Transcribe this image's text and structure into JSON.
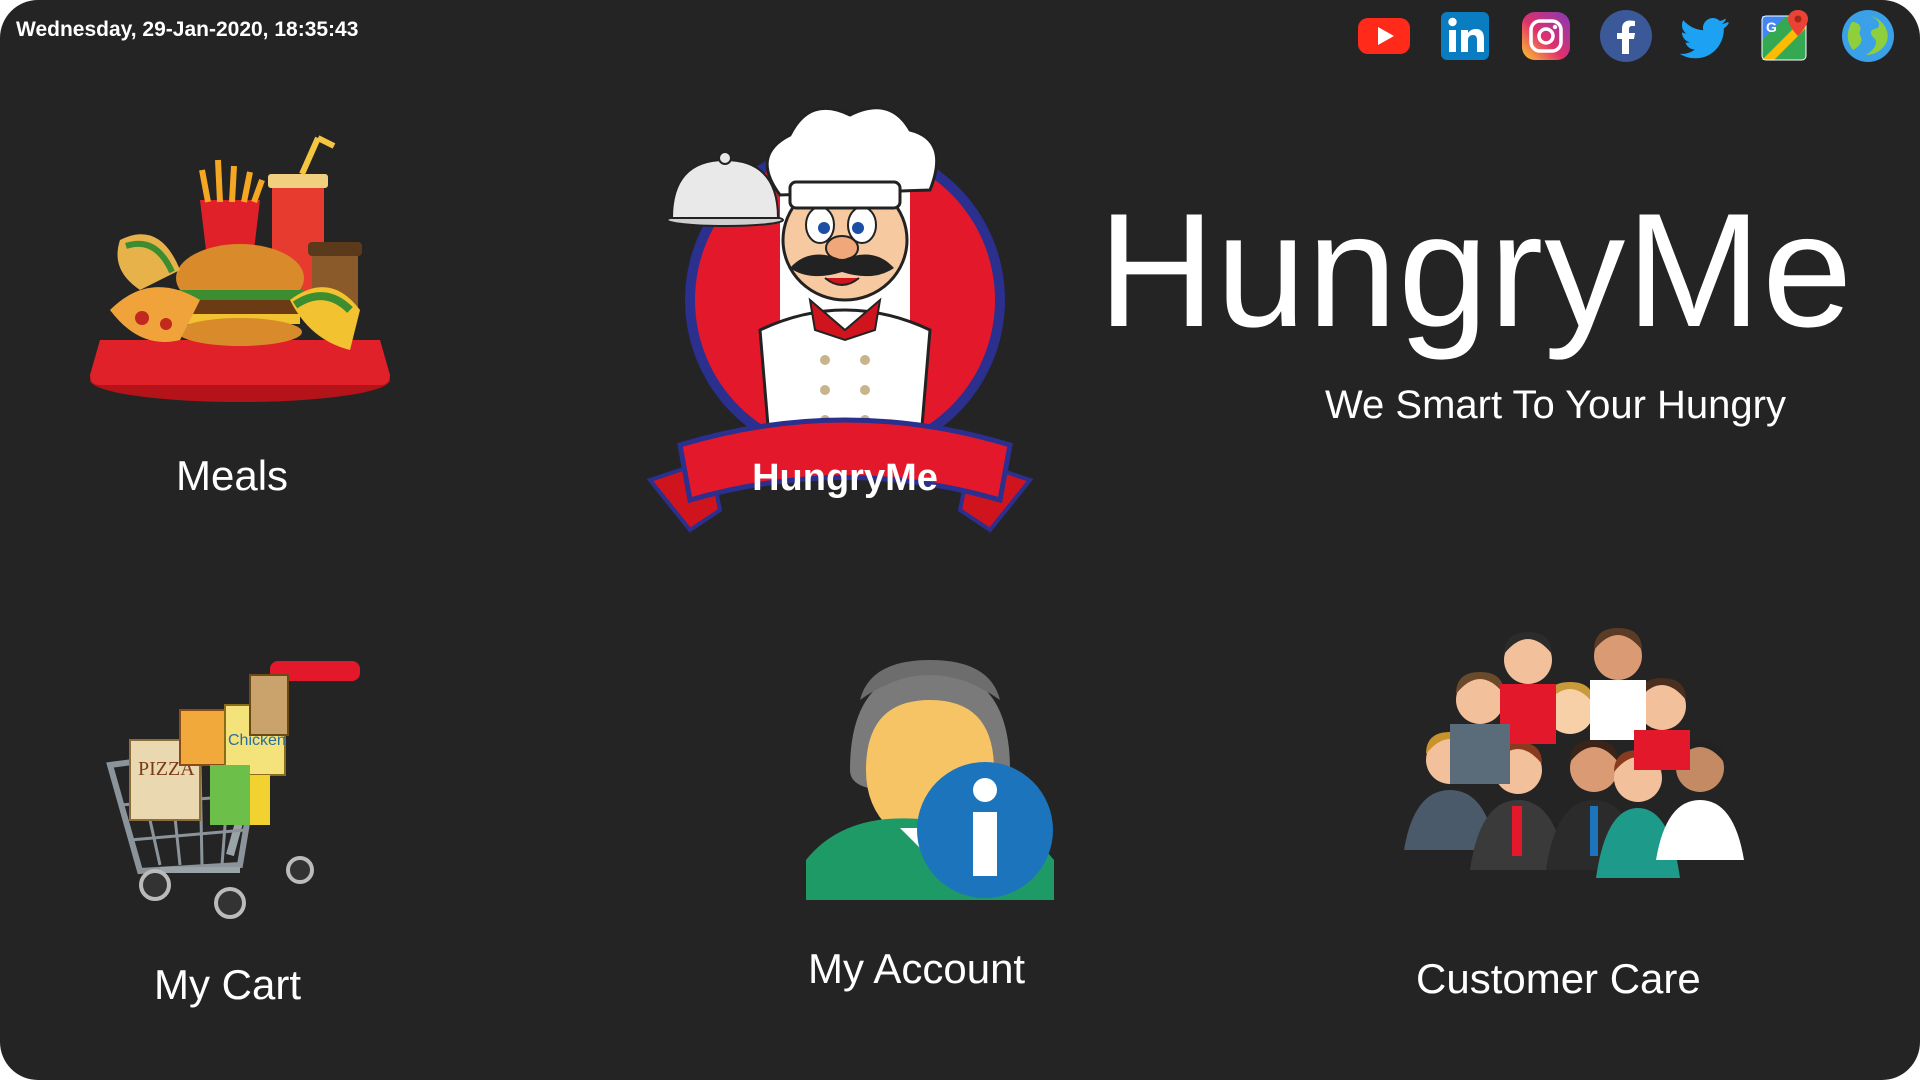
{
  "header": {
    "datetime": "Wednesday, 29-Jan-2020, 18:35:43"
  },
  "social_links": [
    {
      "name": "youtube",
      "icon": "youtube-icon",
      "color": "#ff1f1f"
    },
    {
      "name": "linkedin",
      "icon": "linkedin-icon",
      "color": "#0a7cc1"
    },
    {
      "name": "instagram",
      "icon": "instagram-icon",
      "color": "#d6287a"
    },
    {
      "name": "facebook",
      "icon": "facebook-icon",
      "color": "#3b5998"
    },
    {
      "name": "twitter",
      "icon": "twitter-icon",
      "color": "#1da1f2"
    },
    {
      "name": "google-maps",
      "icon": "google-maps-icon",
      "color": "#34a853"
    },
    {
      "name": "globe",
      "icon": "globe-icon",
      "color": "#2b8fd6"
    }
  ],
  "brand": {
    "name": "HungryMe",
    "tagline": "We Smart To Your Hungry",
    "logo_banner_text": "HungryMe"
  },
  "tiles": {
    "meals": {
      "label": "Meals",
      "icon": "meals-icon"
    },
    "cart": {
      "label": "My Cart",
      "icon": "shopping-cart-icon"
    },
    "account": {
      "label": "My Account",
      "icon": "account-info-icon"
    },
    "care": {
      "label": "Customer Care",
      "icon": "customer-care-icon"
    }
  },
  "colors": {
    "background": "#242424",
    "text": "#ffffff",
    "logo_red": "#e3192b",
    "logo_blue": "#2b2f8e"
  }
}
